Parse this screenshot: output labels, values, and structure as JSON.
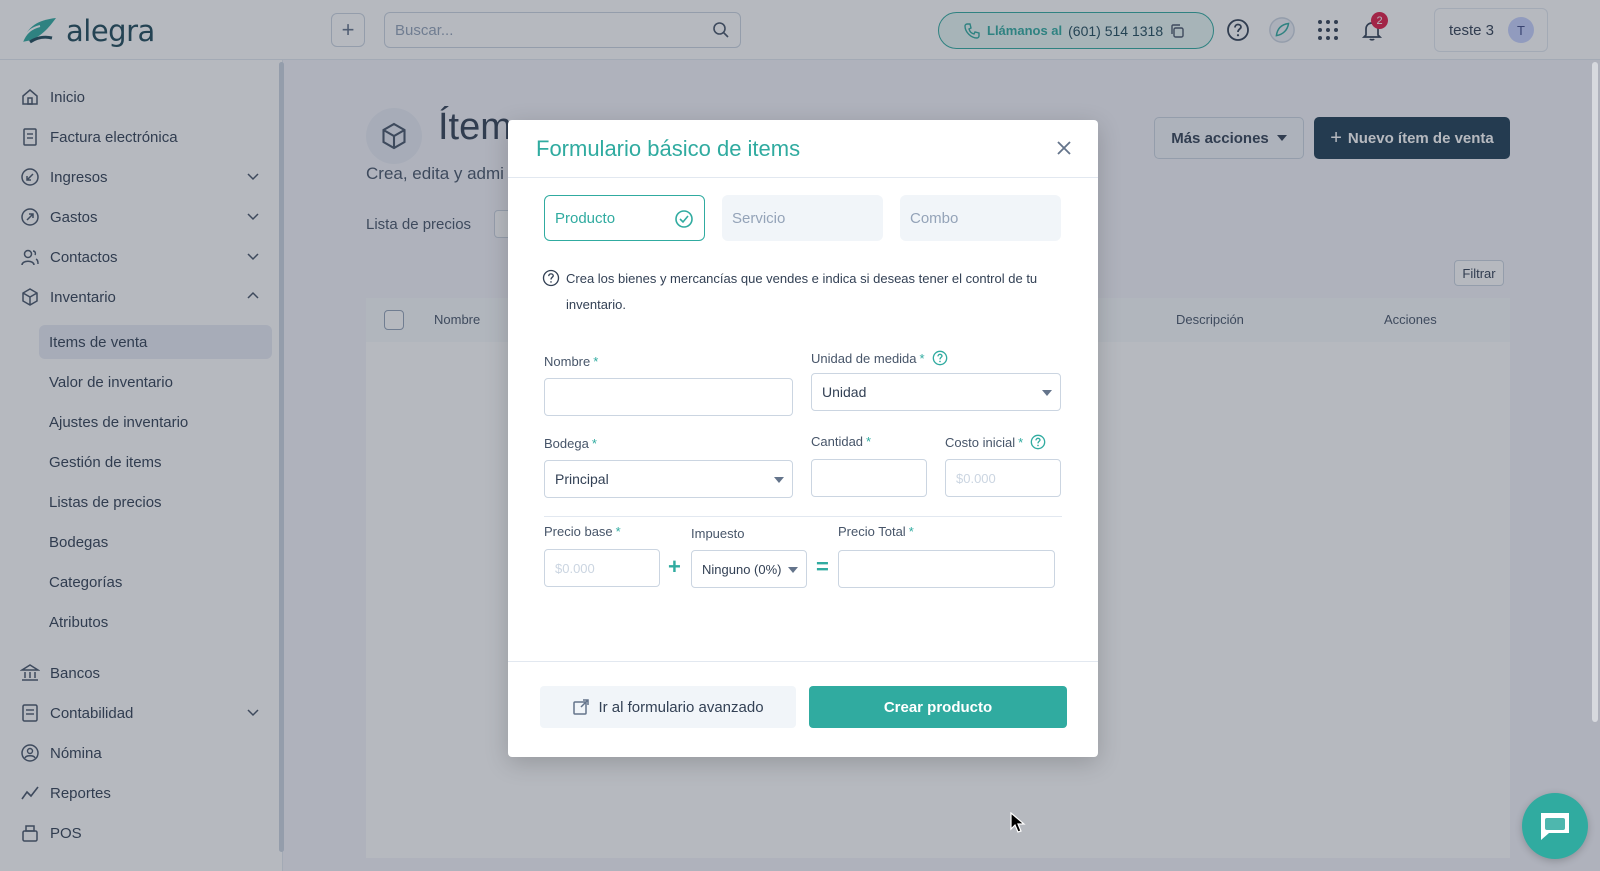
{
  "header": {
    "brand": "alegra",
    "search_placeholder": "Buscar...",
    "call_label": "Llámanos al",
    "call_number": "(601) 514 1318",
    "notification_count": "2",
    "user_name": "teste 3",
    "user_initial": "T"
  },
  "sidebar": {
    "items": [
      {
        "label": "Inicio"
      },
      {
        "label": "Factura electrónica"
      },
      {
        "label": "Ingresos"
      },
      {
        "label": "Gastos"
      },
      {
        "label": "Contactos"
      },
      {
        "label": "Inventario"
      }
    ],
    "inventory_sub": [
      {
        "label": "Items de venta"
      },
      {
        "label": "Valor de inventario"
      },
      {
        "label": "Ajustes de inventario"
      },
      {
        "label": "Gestión de items"
      },
      {
        "label": "Listas de precios"
      },
      {
        "label": "Bodegas"
      },
      {
        "label": "Categorías"
      },
      {
        "label": "Atributos"
      }
    ],
    "lower_items": [
      {
        "label": "Bancos"
      },
      {
        "label": "Contabilidad"
      },
      {
        "label": "Nómina"
      },
      {
        "label": "Reportes"
      },
      {
        "label": "POS"
      }
    ]
  },
  "main": {
    "title": "Ítem",
    "subtitle": "Crea, edita y admi",
    "more_actions": "Más acciones",
    "new_item": "Nuevo ítem de venta",
    "price_list_label": "Lista de precios",
    "filter": "Filtrar",
    "columns": [
      "Nombre",
      "Descripción",
      "Acciones"
    ]
  },
  "modal": {
    "title": "Formulario básico de items",
    "types": [
      "Producto",
      "Servicio",
      "Combo"
    ],
    "info": "Crea los bienes y mercancías que vendes e indica si deseas tener el control de tu inventario.",
    "fields": {
      "name_label": "Nombre",
      "unit_label": "Unidad de medida",
      "unit_value": "Unidad",
      "warehouse_label": "Bodega",
      "warehouse_value": "Principal",
      "quantity_label": "Cantidad",
      "initial_cost_label": "Costo inicial",
      "initial_cost_placeholder": "$0.000",
      "base_price_label": "Precio base",
      "base_price_placeholder": "$0.000",
      "tax_label": "Impuesto",
      "tax_value": "Ninguno (0%)",
      "total_price_label": "Precio Total",
      "required_mark": "*"
    },
    "advanced_link": "Ir al formulario avanzado",
    "create_button": "Crear producto"
  },
  "colors": {
    "accent": "#30aba0",
    "dark_button": "#1f3e55"
  }
}
